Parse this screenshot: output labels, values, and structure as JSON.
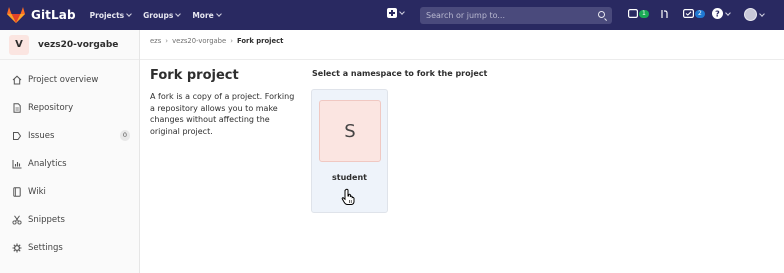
{
  "topbar": {
    "brand": "GitLab",
    "nav": [
      "Projects",
      "Groups",
      "More"
    ],
    "search_placeholder": "Search or jump to...",
    "todo_count": "1",
    "issues_count": "2",
    "colors": {
      "background": "#292961",
      "accent_orange": "#e24329",
      "green": "#1aaa55",
      "blue": "#1f78d1"
    }
  },
  "sidebar": {
    "project_initial": "V",
    "project_name": "vezs20-vorgabe",
    "items": [
      {
        "label": "Project overview",
        "icon": "home-icon"
      },
      {
        "label": "Repository",
        "icon": "doc-icon"
      },
      {
        "label": "Issues",
        "icon": "issues-icon",
        "count": "0"
      },
      {
        "label": "Analytics",
        "icon": "chart-icon"
      },
      {
        "label": "Wiki",
        "icon": "book-icon"
      },
      {
        "label": "Snippets",
        "icon": "scissors-icon"
      },
      {
        "label": "Settings",
        "icon": "gear-icon"
      }
    ]
  },
  "breadcrumb": {
    "items": [
      "ezs",
      "vezs20-vorgabe"
    ],
    "current": "Fork project",
    "separator": "›"
  },
  "main": {
    "title": "Fork project",
    "description": "A fork is a copy of a project. Forking a repository allows you to make changes without affecting the original project.",
    "namespace_heading": "Select a namespace to fork the project",
    "namespace": {
      "initial": "S",
      "name": "student"
    }
  }
}
